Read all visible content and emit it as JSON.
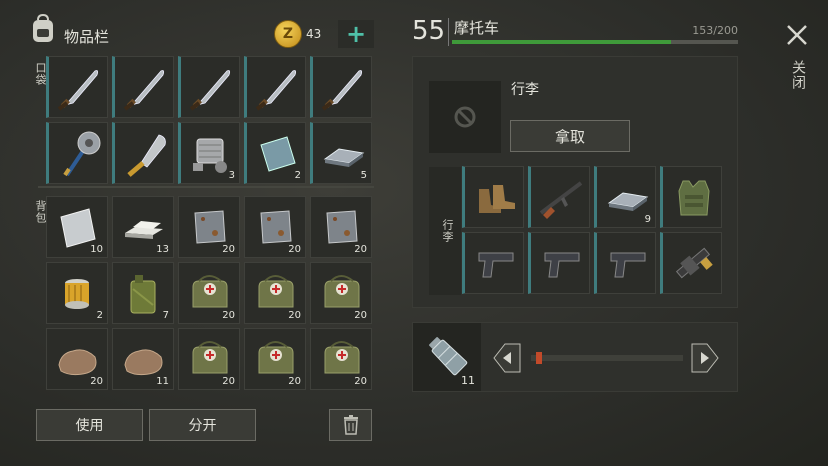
{
  "inventory": {
    "title": "物品栏",
    "coins": "43",
    "pocket_label": "口袋",
    "backpack_label": "背包",
    "pocket_rows": [
      [
        {
          "item": "machete-icon",
          "count": ""
        },
        {
          "item": "machete-icon",
          "count": ""
        },
        {
          "item": "machete-icon",
          "count": ""
        },
        {
          "item": "machete-icon",
          "count": ""
        },
        {
          "item": "machete-icon",
          "count": ""
        }
      ],
      [
        {
          "item": "saw-mace-icon",
          "count": ""
        },
        {
          "item": "cleaver-icon",
          "count": ""
        },
        {
          "item": "engine-part-icon",
          "count": "3"
        },
        {
          "item": "metal-plate-icon",
          "count": "2"
        },
        {
          "item": "iron-bar-icon",
          "count": "5"
        }
      ]
    ],
    "backpack_rows": [
      [
        {
          "item": "steel-sheet-icon",
          "count": "10"
        },
        {
          "item": "aluminum-bars-icon",
          "count": "13"
        },
        {
          "item": "rusty-plate-icon",
          "count": "20"
        },
        {
          "item": "rusty-plate-icon",
          "count": "20"
        },
        {
          "item": "rusty-plate-icon",
          "count": "20"
        }
      ],
      [
        {
          "item": "oil-filter-icon",
          "count": "2"
        },
        {
          "item": "jerrycan-icon",
          "count": "7"
        },
        {
          "item": "medkit-bag-icon",
          "count": "20"
        },
        {
          "item": "medkit-bag-icon",
          "count": "20"
        },
        {
          "item": "medkit-bag-icon",
          "count": "20"
        }
      ],
      [
        {
          "item": "stone-icon",
          "count": "20"
        },
        {
          "item": "stone-icon",
          "count": "11"
        },
        {
          "item": "medkit-bag-icon",
          "count": "20"
        },
        {
          "item": "medkit-bag-icon",
          "count": "20"
        },
        {
          "item": "medkit-bag-icon",
          "count": "20"
        }
      ]
    ],
    "use_label": "使用",
    "split_label": "分开"
  },
  "vehicle": {
    "level": "55",
    "name": "摩托车",
    "capacity": "153/200",
    "capacity_fraction": 0.765,
    "bar_color": "#3f9a3a",
    "luggage_title": "行李",
    "take_label": "拿取",
    "luggage_side_label": "行李",
    "luggage_rows": [
      [
        {
          "item": "boots-icon",
          "count": ""
        },
        {
          "item": "rifle-icon",
          "count": ""
        },
        {
          "item": "iron-bar-icon",
          "count": "9"
        },
        {
          "item": "armor-vest-icon",
          "count": ""
        }
      ],
      [
        {
          "item": "pistol-icon",
          "count": ""
        },
        {
          "item": "pistol-icon",
          "count": ""
        },
        {
          "item": "pistol-icon",
          "count": ""
        },
        {
          "item": "minigun-icon",
          "count": ""
        }
      ]
    ]
  },
  "fuel": {
    "item": "water-bottle-icon",
    "count": "11",
    "slider_fraction": 0.02
  },
  "close_label": "关闭",
  "accent_teal": "#3f7c7e"
}
